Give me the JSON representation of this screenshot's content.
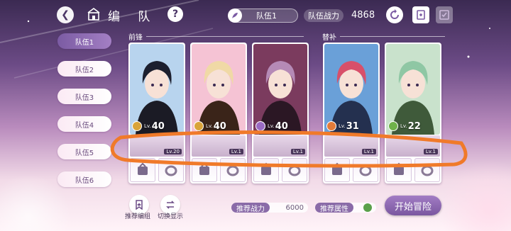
{
  "header": {
    "title": "编 队",
    "team_selector": "队伍1",
    "power_label": "队伍战力",
    "power_value": "4868"
  },
  "team_list": [
    {
      "label": "队伍1",
      "active": true
    },
    {
      "label": "队伍2",
      "active": false
    },
    {
      "label": "队伍3",
      "active": false
    },
    {
      "label": "队伍4",
      "active": false
    },
    {
      "label": "队伍5",
      "active": false
    },
    {
      "label": "队伍6",
      "active": false
    }
  ],
  "sections": {
    "front": "前锋",
    "backup": "替补"
  },
  "cards": [
    {
      "name_icon": "sun-element-icon",
      "element_color": "#d9a43a",
      "lv_prefix": "Lv.",
      "level": "40",
      "sub_level": "Lv.20",
      "hair": "#1c1f2e",
      "bg": "#b8d4ee",
      "outfit": "#1b1b25"
    },
    {
      "name_icon": "sun-element-icon",
      "element_color": "#d9a43a",
      "lv_prefix": "Lv.",
      "level": "40",
      "sub_level": "Lv.1",
      "hair": "#f0d9a6",
      "bg": "#f5c3d4",
      "outfit": "#3a2419"
    },
    {
      "name_icon": "moon-element-icon",
      "element_color": "#9a6bc4",
      "lv_prefix": "Lv.",
      "level": "40",
      "sub_level": "Lv.1",
      "hair": "#b58ab6",
      "bg": "#7b3b5e",
      "outfit": "#2b1724"
    },
    {
      "name_icon": "fire-element-icon",
      "element_color": "#e27b39",
      "lv_prefix": "Lv.",
      "level": "31",
      "sub_level": "Lv.1",
      "hair": "#d8506a",
      "bg": "#6aa0d8",
      "outfit": "#24304f"
    },
    {
      "name_icon": "leaf-element-icon",
      "element_color": "#6fb24a",
      "lv_prefix": "Lv.",
      "level": "22",
      "sub_level": "Lv.1",
      "hair": "#8fc7a4",
      "bg": "#c9e2cc",
      "outfit": "#3f5a3a"
    }
  ],
  "bottom": {
    "recommend_team": "推荐编组",
    "switch_display": "切换显示",
    "recommend_power_label": "推荐战力",
    "recommend_power_value": "6000",
    "recommend_attr_label": "推荐属性",
    "start_button": "开始冒险"
  },
  "colors": {
    "accent": "#8a6ba8",
    "annotation_stroke": "#f07a2a"
  }
}
